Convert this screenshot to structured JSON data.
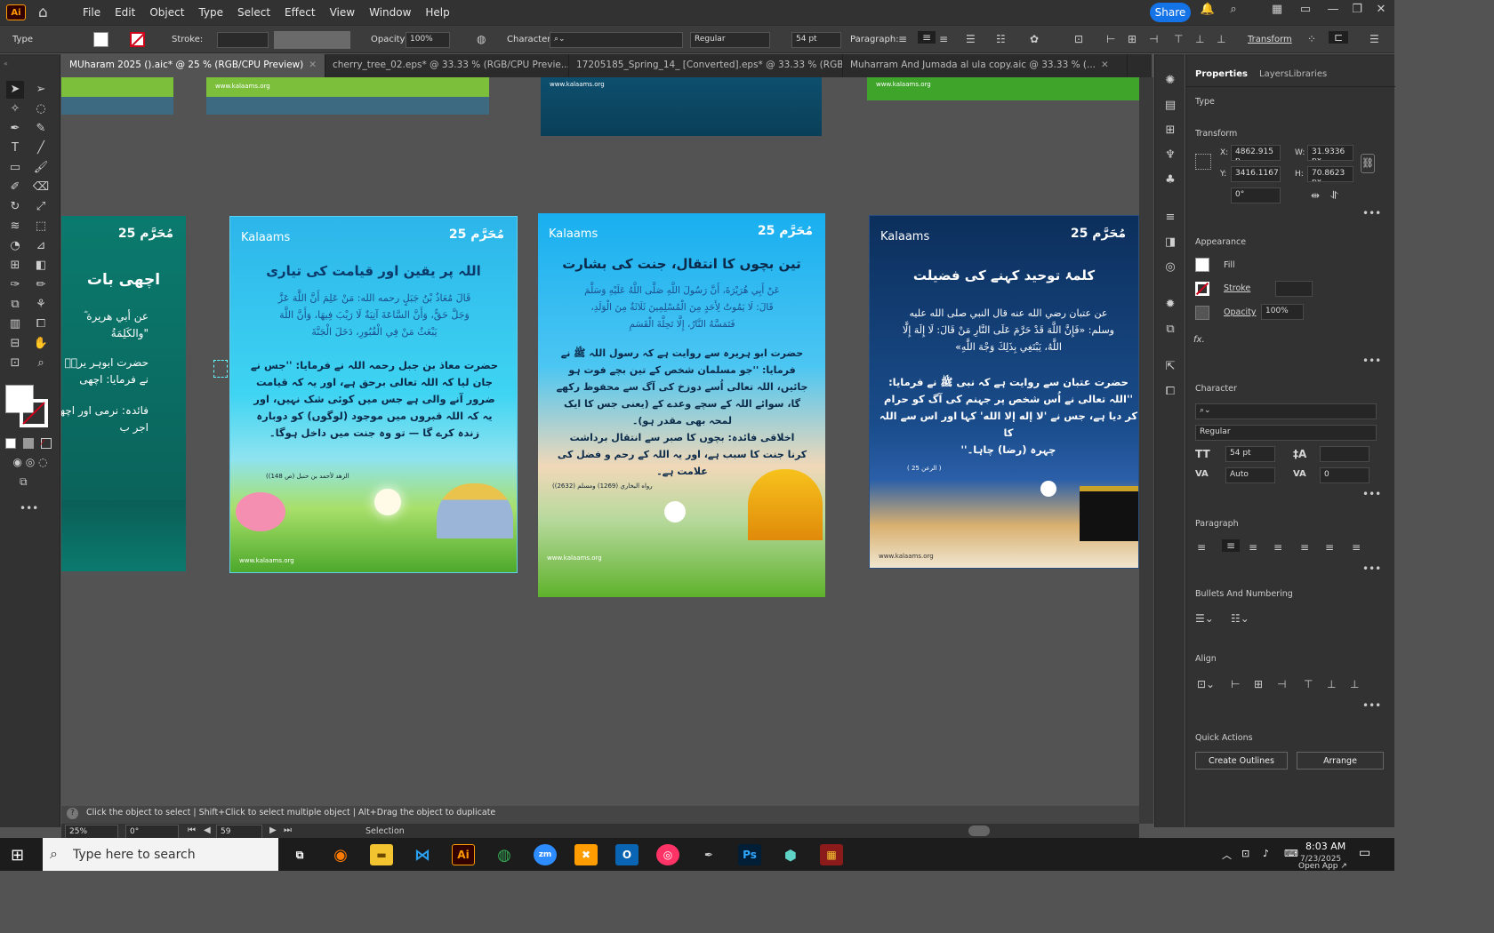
{
  "app": {
    "logo": "Ai",
    "share_label": "Share"
  },
  "menu": [
    "File",
    "Edit",
    "Object",
    "Type",
    "Select",
    "Effect",
    "View",
    "Window",
    "Help"
  ],
  "control": {
    "type_label": "Type",
    "stroke_label": "Stroke:",
    "opacity_label": "Opacity:",
    "opacity_value": "100%",
    "character_label": "Character:",
    "font_style": "Regular",
    "font_size": "54 pt",
    "paragraph_label": "Paragraph:",
    "transform_label": "Transform"
  },
  "tabs": [
    {
      "label": "MUharam 2025 ().aic* @ 25 % (RGB/CPU Preview)",
      "active": true
    },
    {
      "label": "cherry_tree_02.eps* @ 33.33 % (RGB/CPU Previe...",
      "active": false
    },
    {
      "label": "17205185_Spring_14_ [Converted].eps* @ 33.33 % (RGB...",
      "active": false
    },
    {
      "label": "Muharram And Jumada al ula copy.aic @ 33.33 % (...",
      "active": false
    }
  ],
  "canvas": {
    "url_text": "www.kalaams.org",
    "brand": "Kalaams",
    "badge": "مُحَرَّم 25",
    "cards": [
      {
        "title": "اچھی بات",
        "lines": [
          "عن أبي هريرة ؓ",
          "\"والكَلِمَةُ",
          "حضرت ابوہر یرہؓ سے",
          "نے فرمایا: اچھی",
          "فائدہ: نرمی اور اچھ",
          "اجر ب"
        ]
      },
      {
        "title": "اللہ پر یقین اور قیامت کی تیاری",
        "lines": [
          "قَالَ مُعَاذُ بْنُ جَبَلٍ رحمه الله: مَنْ عَلِمَ أَنَّ اللَّهَ عَزَّ",
          "وَجَلَّ حَقٌّ، وَأَنَّ السَّاعَةَ آتِيَةٌ لَا رَيْبَ فِيهَا، وَأَنَّ اللَّهَ",
          "يَبْعَثُ مَنْ فِي الْقُبُورِ، دَخَلَ الْجَنَّةَ",
          "حضرت معاذ بن جبل رحمہ اللہ نے فرمایا: ''جس نے",
          "جان لیا کہ اللہ تعالی برحق ہے، اور یہ کہ قیامت",
          "ضرور آنے والی ہے جس میں کوئی شک نہیں، اور",
          "یہ کہ اللہ قبروں میں موجود (لوگوں) کو دوبارہ",
          "زندہ کرے گا — تو وہ جنت میں داخل ہوگا۔"
        ],
        "ref": "(الزهد لأحمد بن حنبل (ص 148)"
      },
      {
        "title": "تین بچوں کا انتقال، جنت کی بشارت",
        "lines": [
          "عَنْ أَبِي هُرَيْرَةَ، أَنَّ رَسُولَ اللَّهِ صَلَّى اللَّهُ عَلَيْهِ وَسَلَّمَ",
          "قَالَ: لَا يَمُوتُ لِأَحَدٍ مِنَ الْمُسْلِمِينَ ثَلَاثَةٌ مِنَ الْوَلَدِ،",
          "فَتَمَسَّهُ النَّارُ، إِلَّا تَحِلَّةَ الْقَسَمِ",
          "حضرت ابو ہریرہ سے روایت ہے کہ رسول اللہ ﷺ نے",
          "فرمایا: ''جو مسلمان شخص کے تین بچے فوت ہو",
          "جائیں، اللہ تعالی اُسے دوزخ کی آگ سے محفوظ رکھے",
          "گا، سوائے اللہ کے سچے وعدے کے (یعنی جس کا ایک",
          "لمحہ بھی مقدر ہو)۔",
          "اخلاقی فائدہ: بچوں کا صبر سے انتقال برداشت",
          "کرنا جنت کا سبب ہے، اور یہ اللہ کے رحم و فضل کی",
          "علامت ہے۔"
        ],
        "ref": "(رواه البخاري (1269) ومسلم (2632)"
      },
      {
        "title": "کلمۂ توحید کہنے کی فضیلت",
        "lines": [
          "عن عتبان رضي الله عنه قال النبي صلى الله عليه",
          "وسلم: «فَإِنَّ اللَّهَ قَدْ حَرَّمَ عَلَى النَّارِ مَنْ قَالَ: لَا إِلَهَ إِلَّا",
          "اللَّهُ، يَبْتَغِي بِذَلِكَ وَجْهَ اللَّهِ»",
          "حضرت عتبان سے روایت ہے کہ نبی ﷺ نے فرمایا:",
          "''اللہ تعالی نے اُس شخص پر جہنم کی آگ کو حرام",
          "کر دیا ہے، جس نے 'لا إله إلا الله' کہا اور اس سے اللہ کا",
          "چہرہ (رضا) چاہا۔''"
        ],
        "ref": "( الرعن 25 )"
      }
    ]
  },
  "panel": {
    "tabs": [
      "Properties",
      "Layers",
      "Libraries"
    ],
    "type_label": "Type",
    "transform_label": "Transform",
    "x_label": "X:",
    "x_value": "4862.915 p",
    "y_label": "Y:",
    "y_value": "3416.1167",
    "w_label": "W:",
    "w_value": "31.9336 px",
    "h_label": "H:",
    "h_value": "70.8623 px",
    "rotate_value": "0°",
    "appearance_label": "Appearance",
    "fill_label": "Fill",
    "stroke_label": "Stroke",
    "opacity_label": "Opacity",
    "opacity_value": "100%",
    "fx_label": "fx.",
    "character_label": "Character",
    "font_style": "Regular",
    "font_size": "54 pt",
    "leading": "Auto",
    "tracking": "0",
    "paragraph_label": "Paragraph",
    "bullets_label": "Bullets And Numbering",
    "align_label": "Align",
    "quick_actions_label": "Quick Actions",
    "create_outlines": "Create Outlines",
    "arrange": "Arrange"
  },
  "status": {
    "hint": "Click the object to select  |  Shift+Click to select multiple object  |  Alt+Drag the object to duplicate",
    "zoom": "25%",
    "rotation": "0°",
    "artboard": "59",
    "mode": "Selection"
  },
  "taskbar": {
    "search_placeholder": "Type here to search",
    "time": "8:03 AM",
    "date": "7/23/2025",
    "popup": "Open App ↗"
  }
}
